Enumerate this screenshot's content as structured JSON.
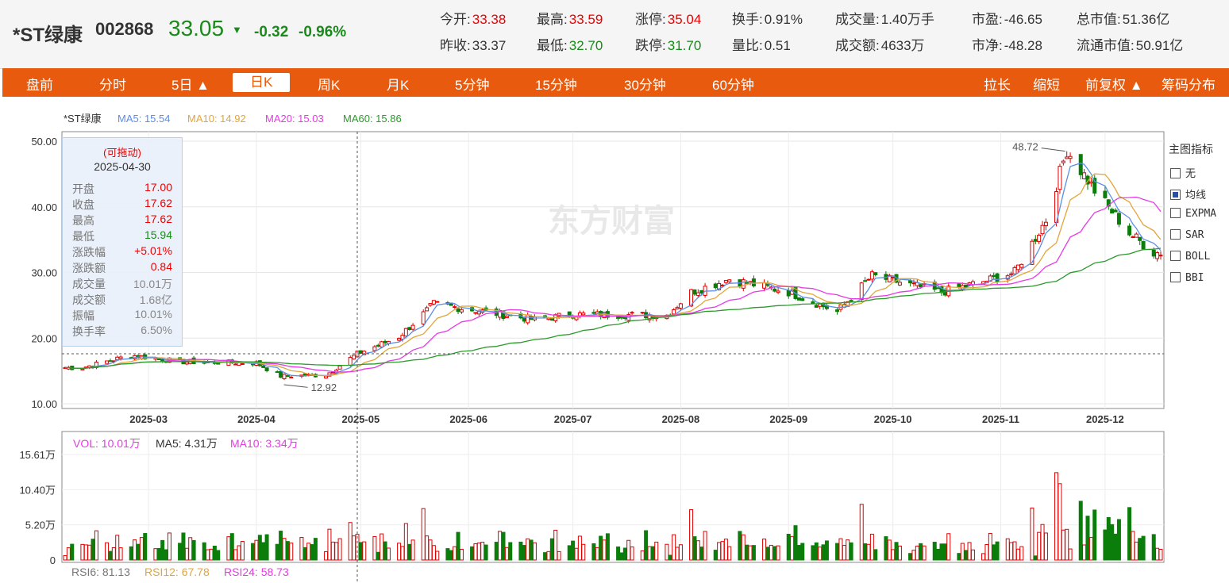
{
  "quote": {
    "name": "*ST绿康",
    "code": "002868",
    "price": "33.05",
    "arrow": "▼",
    "change": "-0.32",
    "change_pct": "-0.96%",
    "stats_row1": [
      {
        "k": "今开:",
        "v": "33.38",
        "c": "red"
      },
      {
        "k": "最高:",
        "v": "33.59",
        "c": "red"
      },
      {
        "k": "涨停:",
        "v": "35.04",
        "c": "red"
      },
      {
        "k": "换手:",
        "v": "0.91%",
        "c": ""
      },
      {
        "k": "成交量:",
        "v": "1.40万手",
        "c": ""
      },
      {
        "k": "市盈:",
        "v": "-46.65",
        "c": ""
      },
      {
        "k": "总市值:",
        "v": "51.36亿",
        "c": ""
      }
    ],
    "stats_row2": [
      {
        "k": "昨收:",
        "v": "33.37",
        "c": ""
      },
      {
        "k": "最低:",
        "v": "32.70",
        "c": "grn"
      },
      {
        "k": "跌停:",
        "v": "31.70",
        "c": "grn"
      },
      {
        "k": "量比:",
        "v": "0.51",
        "c": ""
      },
      {
        "k": "成交额:",
        "v": "4633万",
        "c": ""
      },
      {
        "k": "市净:",
        "v": "-48.28",
        "c": ""
      },
      {
        "k": "流通市值:",
        "v": "50.91亿",
        "c": ""
      }
    ]
  },
  "tabs": [
    "盘前",
    "分时",
    "5日 ▲",
    "日K",
    "周K",
    "月K",
    "5分钟",
    "15分钟",
    "30分钟",
    "60分钟"
  ],
  "tabs_right": [
    "拉长",
    "缩短",
    "前复权 ▲",
    "筹码分布"
  ],
  "active_tab": "日K",
  "watermark": "东方财富",
  "ma_legend": {
    "name": "*ST绿康",
    "ma5": "MA5: 15.54",
    "ma10": "MA10: 14.92",
    "ma20": "MA20: 15.03",
    "ma60": "MA60: 15.86"
  },
  "vol_legend": {
    "vol": "VOL: 10.01万",
    "ma5": "MA5: 4.31万",
    "ma10": "MA10: 3.34万"
  },
  "rsi_legend": {
    "rsi6": "RSI6: 81.13",
    "rsi12": "RSI12: 67.78",
    "rsi24": "RSI24: 58.73"
  },
  "tooltip": {
    "drag": "(可拖动)",
    "date": "2025-04-30",
    "rows": [
      {
        "k": "开盘",
        "v": "17.00",
        "c": "red"
      },
      {
        "k": "收盘",
        "v": "17.62",
        "c": "red"
      },
      {
        "k": "最高",
        "v": "17.62",
        "c": "red"
      },
      {
        "k": "最低",
        "v": "15.94",
        "c": "grn"
      },
      {
        "k": "涨跌幅",
        "v": "+5.01%",
        "c": "red"
      },
      {
        "k": "涨跌额",
        "v": "0.84",
        "c": "red"
      },
      {
        "k": "成交量",
        "v": "10.01万",
        "c": "gray"
      },
      {
        "k": "成交额",
        "v": "1.68亿",
        "c": "gray"
      },
      {
        "k": "振幅",
        "v": "10.01%",
        "c": "gray"
      },
      {
        "k": "换手率",
        "v": "6.50%",
        "c": "gray"
      }
    ]
  },
  "sidebar": {
    "title": "主图指标",
    "items": [
      {
        "label": "无",
        "on": false
      },
      {
        "label": "均线",
        "on": true
      },
      {
        "label": "EXPMA",
        "on": false
      },
      {
        "label": "SAR",
        "on": false
      },
      {
        "label": "BOLL",
        "on": false
      },
      {
        "label": "BBI",
        "on": false
      }
    ]
  },
  "colors": {
    "up": "#e00000",
    "down": "#0a7d0a",
    "ma5": "#5b8ee6",
    "ma10": "#e2a53a",
    "ma20": "#e63ae6",
    "ma60": "#2a9a2a",
    "accent": "#e85a0e"
  },
  "chart_data": [
    {
      "type": "candlestick",
      "ylim": [
        10,
        50
      ],
      "yticks": [
        "50.00",
        "40.00",
        "30.00",
        "20.00",
        "10.00"
      ],
      "xticks": [
        "2025-03",
        "2025-04",
        "2025-05",
        "2025-06",
        "2025-07",
        "2025-08",
        "2025-09",
        "2025-10",
        "2025-11",
        "2025-12"
      ],
      "annotations": [
        {
          "text": "48.72",
          "kind": "high"
        },
        {
          "text": "12.92",
          "kind": "low"
        }
      ],
      "anchors": [
        {
          "date": "2025-02-10",
          "close": 15.5
        },
        {
          "date": "2025-02-24",
          "close": 17.4
        },
        {
          "date": "2025-03-10",
          "close": 16.4
        },
        {
          "date": "2025-04-01",
          "close": 16.2
        },
        {
          "date": "2025-04-08",
          "close": 14.2
        },
        {
          "date": "2025-04-21",
          "close": 14.4
        },
        {
          "date": "2025-04-30",
          "close": 17.62
        },
        {
          "date": "2025-05-12",
          "close": 20.2
        },
        {
          "date": "2025-05-22",
          "close": 25.2
        },
        {
          "date": "2025-06-06",
          "close": 24.0
        },
        {
          "date": "2025-06-20",
          "close": 22.8
        },
        {
          "date": "2025-07-01",
          "close": 23.6
        },
        {
          "date": "2025-07-28",
          "close": 23.5
        },
        {
          "date": "2025-08-04",
          "close": 27.0
        },
        {
          "date": "2025-08-15",
          "close": 29.0
        },
        {
          "date": "2025-09-01",
          "close": 27.0
        },
        {
          "date": "2025-09-15",
          "close": 24.0
        },
        {
          "date": "2025-09-25",
          "close": 29.5
        },
        {
          "date": "2025-10-15",
          "close": 27.0
        },
        {
          "date": "2025-10-27",
          "close": 28.6
        },
        {
          "date": "2025-11-05",
          "close": 30.0
        },
        {
          "date": "2025-11-14",
          "close": 38.0
        },
        {
          "date": "2025-11-20",
          "close": 48.72
        },
        {
          "date": "2025-11-28",
          "close": 42.5
        },
        {
          "date": "2025-12-08",
          "close": 36.0
        },
        {
          "date": "2025-12-15",
          "close": 33.05
        }
      ]
    },
    {
      "type": "bar",
      "name": "volume",
      "ylim": [
        0,
        15.61
      ],
      "yticks": [
        "15.61万",
        "10.40万",
        "5.20万",
        "0"
      ]
    }
  ]
}
